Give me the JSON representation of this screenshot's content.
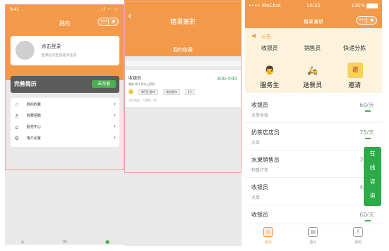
{
  "panel1": {
    "status_time": "9:41",
    "status_icons": "..ıl ◠ ▭",
    "title": "我的",
    "capsule_dots": "•••",
    "capsule_target": "◉",
    "login": {
      "title": "点击登录",
      "subtitle": "登录后可查看更多信息"
    },
    "resume": {
      "title": "完善简历",
      "button": "去完善"
    },
    "menu": [
      {
        "label": "我的收藏",
        "icon": "star-icon",
        "glyph": "☆"
      },
      {
        "label": "我要招聘",
        "icon": "person-icon",
        "glyph": "♙"
      },
      {
        "label": "服务中心",
        "icon": "service-icon",
        "glyph": "⌂"
      },
      {
        "label": "用户设置",
        "icon": "gear-icon",
        "glyph": "⚙"
      }
    ],
    "tabbar": [
      {
        "icon": "home-icon",
        "glyph": "⌂"
      },
      {
        "icon": "message-icon",
        "glyph": "✉"
      },
      {
        "icon": "profile-icon",
        "glyph": "●"
      }
    ]
  },
  "panel2": {
    "back": "‹",
    "title": "糖果兼职",
    "subtitle": "我的收藏",
    "job": {
      "name": "收银员",
      "pay": "300-500",
      "meta": "服务 两个月以上经验",
      "tags": [
        "新百汇超市",
        "南京超市",
        "1人"
      ],
      "footer": "工作轻松，可兼职一周"
    }
  },
  "panel3": {
    "status_left": "•••• WeChat",
    "status_time": "16:31",
    "status_battery": "100%",
    "title": "糖果兼职",
    "notice_label": "公告",
    "top_categories": [
      "收银员",
      "销售员",
      "快递分拣"
    ],
    "categories": [
      {
        "label": "服务生",
        "icon": "waiter-icon",
        "glyph": "👨"
      },
      {
        "label": "送餐员",
        "icon": "delivery-icon",
        "glyph": "🛵"
      },
      {
        "label": "邀请",
        "icon": "invite-icon",
        "glyph": "邀"
      }
    ],
    "jobs": [
      {
        "name": "收银员",
        "desc": "点单收银",
        "price": "60",
        "unit": "/天"
      },
      {
        "name": "奶茶店店员",
        "desc": "点单",
        "price": "75",
        "unit": "/天"
      },
      {
        "name": "水果销售员",
        "desc": "称重打单",
        "price": "70",
        "unit": "/天"
      },
      {
        "name": "收银员",
        "desc": "点单",
        "price": "40",
        "unit": "/天"
      },
      {
        "name": "收银员",
        "desc": "",
        "price": "60",
        "unit": "/天"
      }
    ],
    "consult": [
      "在",
      "线",
      "咨",
      "询"
    ],
    "tabs": [
      {
        "label": "首页",
        "icon": "home-icon",
        "glyph": "⌂"
      },
      {
        "label": "图片",
        "icon": "document-icon",
        "glyph": "▤"
      },
      {
        "label": "我的",
        "icon": "user-icon",
        "glyph": "♙"
      }
    ]
  }
}
